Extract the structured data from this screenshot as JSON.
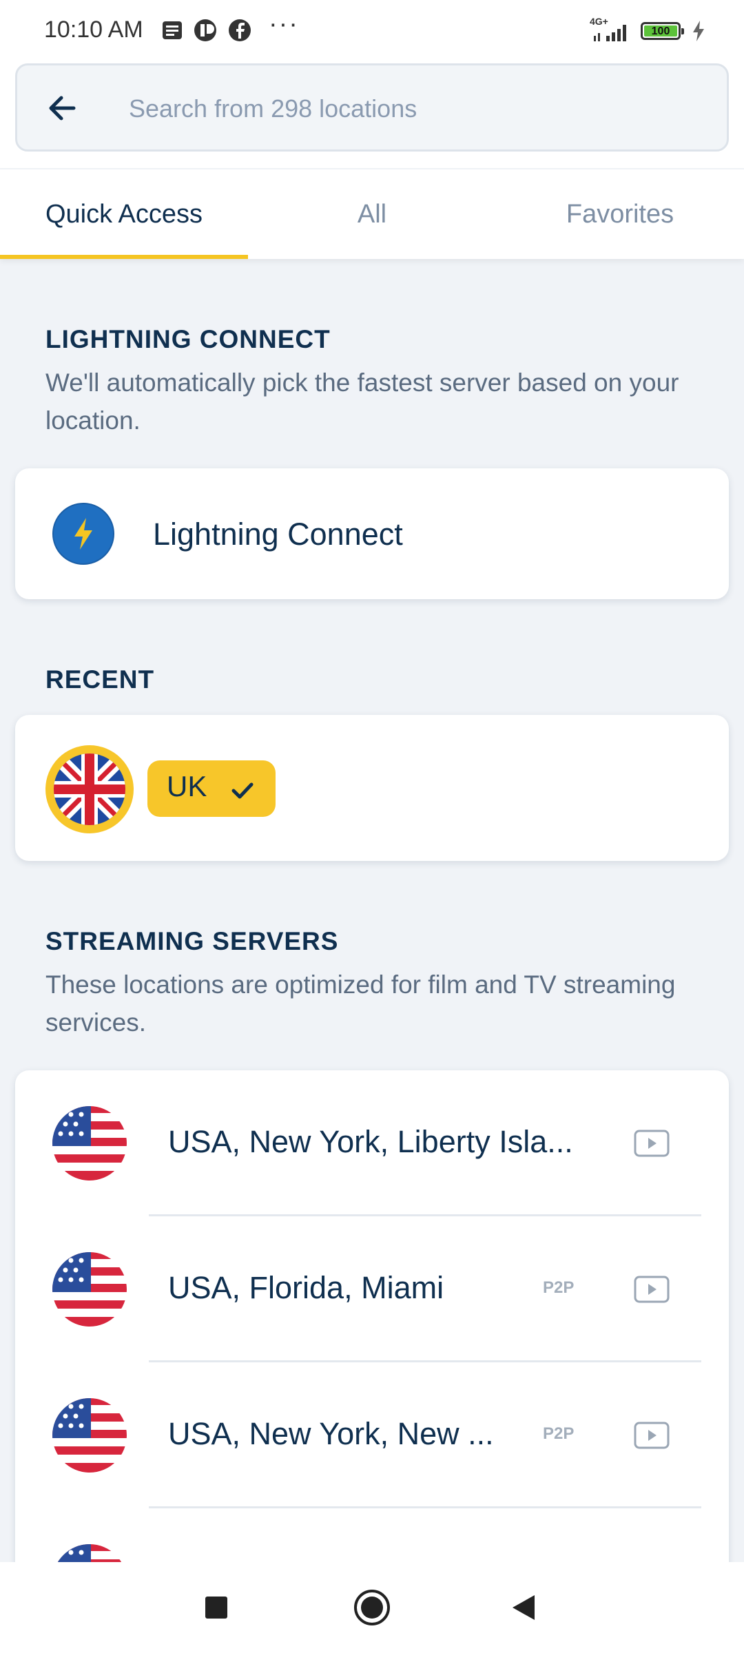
{
  "status_bar": {
    "time": "10:10 AM",
    "network": "4G+",
    "battery": "100",
    "icons": [
      "message-icon",
      "app-icon",
      "facebook-icon",
      "more-icon",
      "signal-icon",
      "battery-icon",
      "charging-icon"
    ],
    "more": "···"
  },
  "search": {
    "placeholder": "Search from 298 locations",
    "value": ""
  },
  "tabs": [
    {
      "label": "Quick Access",
      "active": true
    },
    {
      "label": "All",
      "active": false
    },
    {
      "label": "Favorites",
      "active": false
    }
  ],
  "lightning": {
    "title": "LIGHTNING CONNECT",
    "description": "We'll automatically pick the fastest server based on your location.",
    "button_label": "Lightning Connect"
  },
  "recent": {
    "title": "RECENT",
    "items": [
      {
        "label": "UK",
        "flag": "uk-flag-icon",
        "connected": true
      }
    ]
  },
  "streaming": {
    "title": "STREAMING SERVERS",
    "description": "These locations are optimized for film and TV streaming services.",
    "servers": [
      {
        "name": "USA, New York, Liberty Isla...",
        "p2p": "",
        "flag": "us-flag-icon"
      },
      {
        "name": "USA, Florida, Miami",
        "p2p": "P2P",
        "flag": "us-flag-icon"
      },
      {
        "name": "USA, New York, New ...",
        "p2p": "P2P",
        "flag": "us-flag-icon"
      }
    ]
  },
  "colors": {
    "accent": "#f5c523",
    "primary_text": "#0f2f4f",
    "secondary_text": "#5a6b80",
    "background": "#f0f3f7",
    "lightning_blue": "#1f6fc1"
  },
  "nav_bar": {
    "icons": [
      "recents-square-icon",
      "home-circle-icon",
      "back-triangle-icon"
    ]
  }
}
